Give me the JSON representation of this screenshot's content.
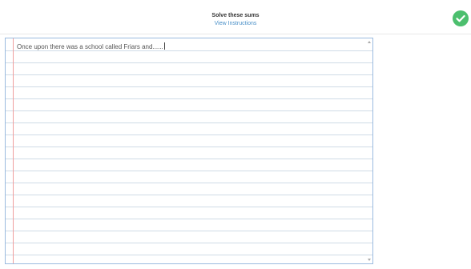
{
  "header": {
    "title": "Solve these sums",
    "instructions_link": "View Instructions"
  },
  "status": {
    "icon": "checkmark-circle-icon",
    "color": "#4cbf6e"
  },
  "editor": {
    "text": "Once upon there was a school called Friars and......"
  }
}
